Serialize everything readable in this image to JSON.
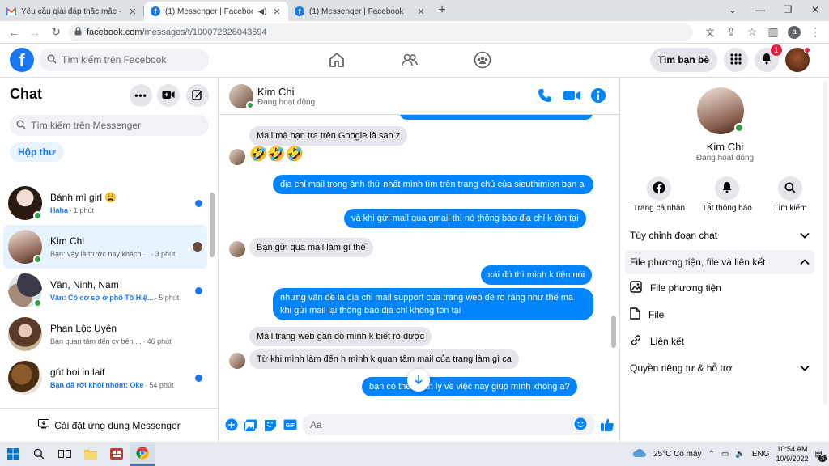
{
  "browser": {
    "tabs": [
      {
        "title": "Yêu cầu giải đáp thắc mắc - anhtu",
        "active": false
      },
      {
        "title": "(1) Messenger | Facebook",
        "active": true
      },
      {
        "title": "(1) Messenger | Facebook",
        "active": false
      }
    ],
    "url_domain": "facebook.com",
    "url_path": "/messages/t/100072828043694",
    "profile_initial": "a"
  },
  "fb": {
    "search_placeholder": "Tìm kiếm trên Facebook",
    "friends_button": "Tìm bạn bè",
    "notification_count": "1"
  },
  "left": {
    "title": "Chat",
    "search_placeholder": "Tìm kiếm trên Messenger",
    "inbox_label": "Hộp thư",
    "conversations": [
      {
        "name": "Bánh mì girl 😩",
        "preview": "Haha",
        "time": "1 phút",
        "unread": true,
        "selected": false,
        "online": true
      },
      {
        "name": "Kim Chi",
        "preview": "Bạn: vậy là trước nay khách ...",
        "time": "3 phút",
        "unread": false,
        "selected": true,
        "online": true
      },
      {
        "name": "Vân, Ninh, Nam",
        "preview": "Vân: Có cơ sở ở phố Tô Hiệ...",
        "time": "5 phút",
        "unread": true,
        "selected": false,
        "online": true
      },
      {
        "name": "Phan Lộc Uyên",
        "preview": "Bạn quan tâm đến cv bên ...",
        "time": "46 phút",
        "unread": false,
        "selected": false,
        "online": false
      },
      {
        "name": "gút boi in laif",
        "preview": "Bạn đã rời khỏi nhóm: Oke",
        "time": "54 phút",
        "unread": true,
        "selected": false,
        "online": false
      }
    ],
    "install_label": "Cài đặt ứng dụng Messenger"
  },
  "conversation": {
    "name": "Kim Chi",
    "status": "Đang hoạt động",
    "emojis": "🤣🤣🤣",
    "messages": [
      {
        "dir": "in",
        "text": "Mail mà bạn tra trên Google là sao z"
      },
      {
        "dir": "out",
        "text": "địa chỉ mail trong ảnh thứ nhất mình tìm trên trang chủ của sieuthimion bạn ạ"
      },
      {
        "dir": "out",
        "text": "và khi gửi mail qua gmail thì nó thông báo địa chỉ k tồn tại"
      },
      {
        "dir": "in",
        "text": "Bạn gửi qua mail làm gì thế"
      },
      {
        "dir": "out",
        "text": "cái đó thì mình k tiện nói"
      },
      {
        "dir": "out",
        "text": "nhưng vấn đề là địa chỉ mail support của trang web đề rõ ràng như thế mà khi gửi mail lại thông báo địa chỉ không tồn tại"
      },
      {
        "dir": "in",
        "text": "Mail trang web gần đó mình k biết rõ được"
      },
      {
        "dir": "in",
        "text": "Từ khi mình làm đến h mình k quan tâm mail của trang làm gì ca"
      },
      {
        "dir": "out",
        "text": "bạn có thể    quản lý về việc này giúp mình không a?"
      }
    ],
    "composer_placeholder": "Aa"
  },
  "right": {
    "name": "Kim Chi",
    "status": "Đang hoạt động",
    "actions": [
      "Trang cá nhân",
      "Tắt thông báo",
      "Tìm kiếm"
    ],
    "sections": {
      "customize": "Tùy chỉnh đoạn chat",
      "media": "File phương tiện, file và liên kết",
      "media_files": "File phương tiện",
      "files": "File",
      "links": "Liên kết",
      "privacy": "Quyền riêng tư & hỗ trợ"
    }
  },
  "taskbar": {
    "weather": "25°C  Có mây",
    "language": "ENG",
    "time": "10:54 AM",
    "date": "10/9/2022",
    "notif_count": "3"
  },
  "colors": {
    "brand": "#1877f2",
    "out_bubble": "#0084ff",
    "online": "#31a24c"
  }
}
